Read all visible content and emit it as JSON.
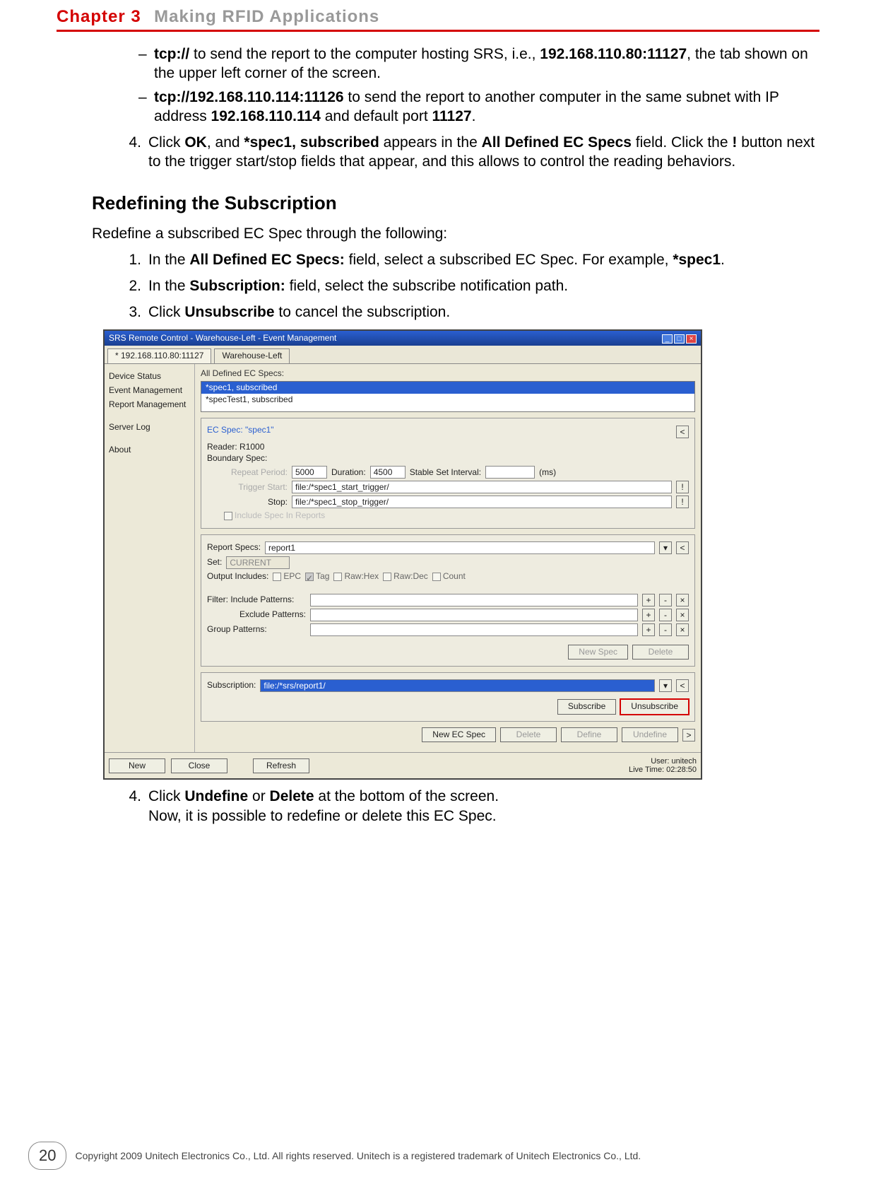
{
  "chapter": {
    "num": "Chapter 3",
    "title": "Making RFID Applications"
  },
  "bullets": {
    "b1a": "tcp://",
    "b1b": " to send the report to the computer hosting SRS, i.e., ",
    "b1c": "192.168.110.80:11127",
    "b1d": ", the tab shown on the upper left corner of the screen.",
    "b2a": "tcp://192.168.110.114:11126",
    "b2b": " to send the report to another computer in the same subnet with IP address ",
    "b2c": "192.168.110.114",
    "b2d": " and default port ",
    "b2e": "11127",
    "b2f": "."
  },
  "step4a": "4.",
  "step4t1": "Click ",
  "step4t2": "OK",
  "step4t3": ", and ",
  "step4t4": "*spec1, subscribed",
  "step4t5": " appears in the ",
  "step4t6": "All Defined EC Specs",
  "step4t7": " field. Click the ",
  "step4t8": "!",
  "step4t9": " button next to the trigger start/stop fields that appear, and this allows to control the reading behaviors.",
  "sect": "Redefining the Subscription",
  "intro": "Redefine a subscribed EC Spec through the following:",
  "s1n": "1.",
  "s1a": "In the ",
  "s1b": "All Defined EC Specs:",
  "s1c": " field, select a subscribed EC Spec. For example, ",
  "s1d": "*spec1",
  "s1e": ".",
  "s2n": "2.",
  "s2a": "In the ",
  "s2b": "Subscription:",
  "s2c": " field, select the subscribe notification path.",
  "s3n": "3.",
  "s3a": "Click ",
  "s3b": "Unsubscribe",
  "s3c": " to cancel the subscription.",
  "s4n": "4.",
  "s4a": "Click ",
  "s4b": "Undefine",
  "s4c": " or ",
  "s4d": "Delete",
  "s4e": " at the bottom of the screen.",
  "s4f": "Now, it is possible to redefine or delete this EC Spec.",
  "app": {
    "title": "SRS Remote Control - Warehouse-Left - Event Management",
    "tab1": "* 192.168.110.80:11127",
    "tab2": "Warehouse-Left",
    "side": {
      "i1": "Device Status",
      "i2": "Event Management",
      "i3": "Report Management",
      "i4": "Server Log",
      "i5": "About"
    },
    "lblAllDefined": "All Defined EC Specs:",
    "list1": "*spec1, subscribed",
    "list2": "*specTest1, subscribed",
    "panelTitle": "EC Spec: \"spec1\"",
    "reader": "Reader: R1000",
    "boundary": "Boundary Spec:",
    "repeatPeriod": "Repeat Period:",
    "repeatVal": "5000",
    "duration": "Duration:",
    "durationVal": "4500",
    "stable": "Stable Set Interval:",
    "ms": "(ms)",
    "triggerStart": "Trigger Start:",
    "triggerStartVal": "file:/*spec1_start_trigger/",
    "stop": "Stop:",
    "stopVal": "file:/*spec1_stop_trigger/",
    "includeSpec": "Include Spec In Reports",
    "reportSpecs": "Report Specs:",
    "reportVal": "report1",
    "set": "Set:",
    "setVal": "CURRENT",
    "outputInc": "Output Includes:",
    "chkEPC": "EPC",
    "chkTag": "Tag",
    "chkRawHex": "Raw:Hex",
    "chkRawDec": "Raw:Dec",
    "chkCount": "Count",
    "filterInc": "Filter: Include Patterns:",
    "filterExc": "Exclude Patterns:",
    "groupPat": "Group Patterns:",
    "newSpec": "New Spec",
    "deleteMini": "Delete",
    "subscription": "Subscription:",
    "subVal": "file:/*srs/report1/",
    "subscribe": "Subscribe",
    "unsubscribe": "Unsubscribe",
    "newEC": "New EC Spec",
    "delete": "Delete",
    "define": "Define",
    "undefine": "Undefine",
    "newBtn": "New",
    "closeBtn": "Close",
    "refresh": "Refresh",
    "user": "User: unitech",
    "live": "Live Time: 02:28:50"
  },
  "pageNo": "20",
  "copyright": "Copyright 2009 Unitech Electronics Co., Ltd. All rights reserved. Unitech is a registered trademark of Unitech Electronics Co., Ltd."
}
